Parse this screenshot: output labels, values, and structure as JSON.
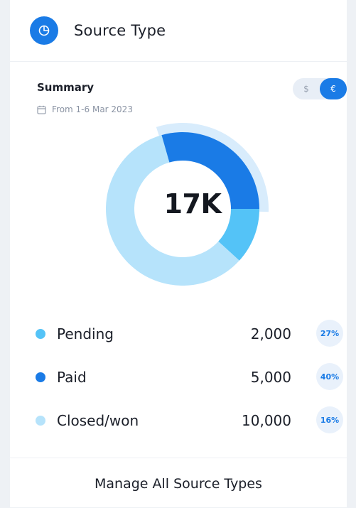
{
  "header": {
    "title": "Source Type",
    "icon": "pie-chart-icon",
    "accent": "#1a7be6"
  },
  "summary": {
    "title": "Summary",
    "date_icon": "calendar-icon",
    "date_range": "From 1-6 Mar 2023"
  },
  "currency_toggle": {
    "options": [
      "$",
      "€"
    ],
    "selected": "€"
  },
  "chart": {
    "center_label": "17K"
  },
  "chart_data": {
    "type": "pie",
    "center_label": "17K",
    "categories": [
      "Pending",
      "Paid",
      "Closed/won"
    ],
    "values": [
      2000,
      5000,
      10000
    ],
    "percent_labels": [
      "27%",
      "40%",
      "16%"
    ],
    "colors": [
      "#54c3f7",
      "#1a7be6",
      "#b6e3fb"
    ]
  },
  "legend": [
    {
      "label": "Pending",
      "value": "2,000",
      "percent": "27%",
      "color": "#54c3f7"
    },
    {
      "label": "Paid",
      "value": "5,000",
      "percent": "40%",
      "color": "#1a7be6"
    },
    {
      "label": "Closed/won",
      "value": "10,000",
      "percent": "16%",
      "color": "#b6e3fb"
    }
  ],
  "footer": {
    "link_label": "Manage All Source Types"
  }
}
